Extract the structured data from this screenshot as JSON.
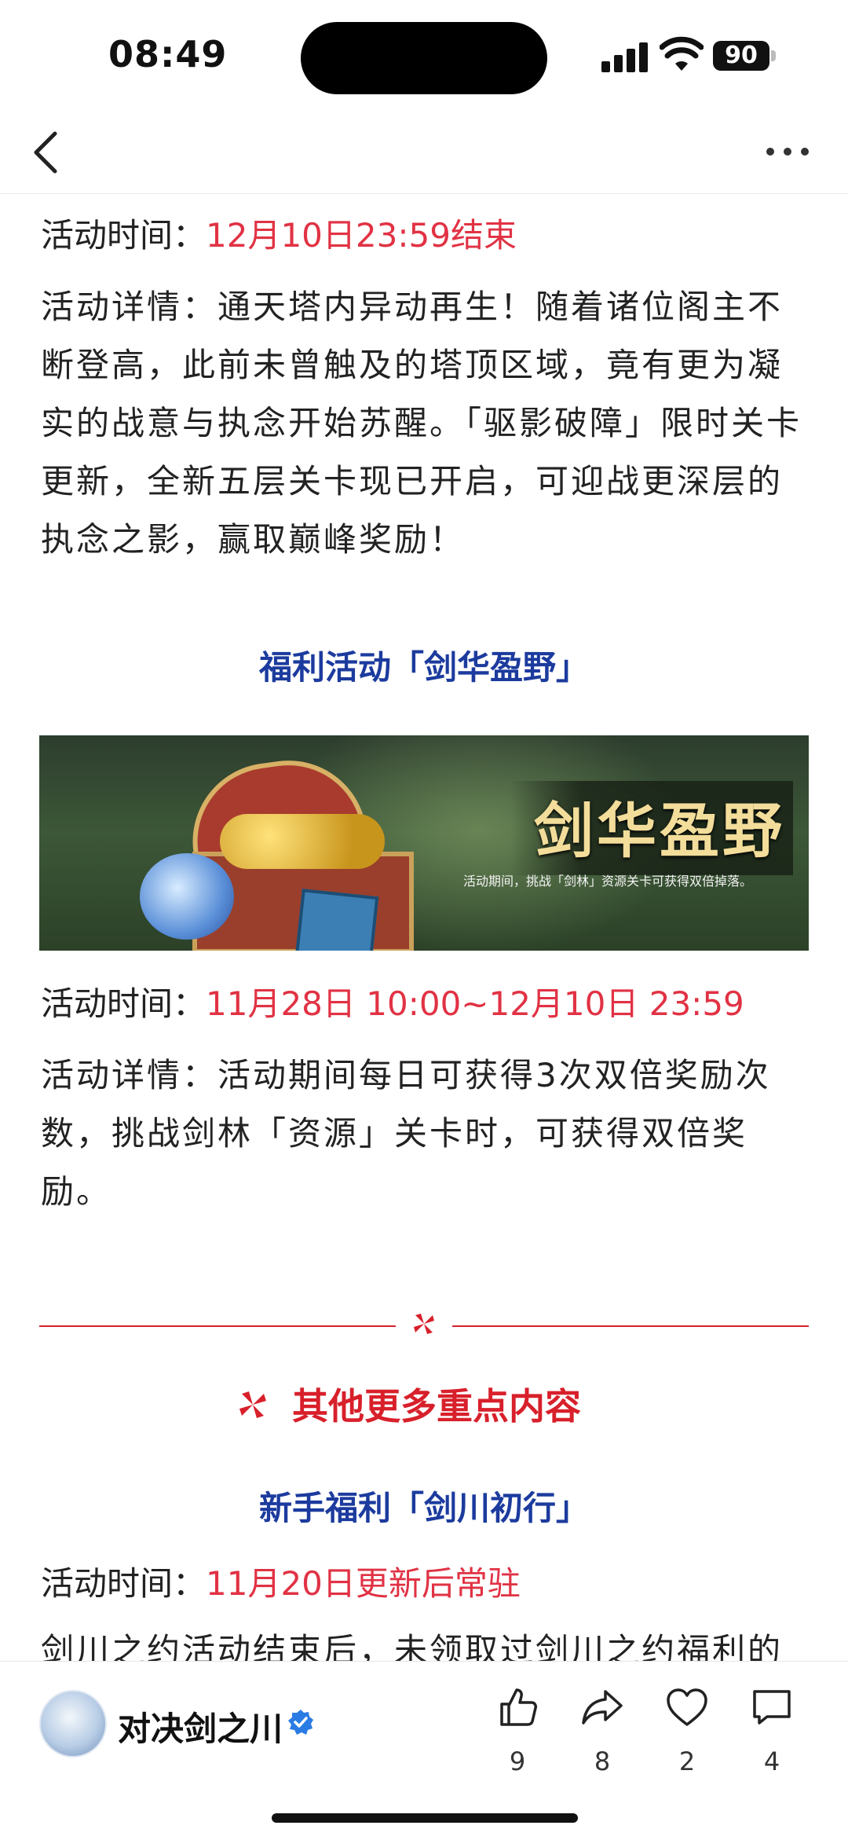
{
  "status_bar": {
    "time": "08:49",
    "battery": "90"
  },
  "nav": {
    "back_icon": "chevron-left-icon",
    "more_icon": "more-dots-icon"
  },
  "article": {
    "block1": {
      "time_label": "活动时间：",
      "time_value": "12月10日23:59结束",
      "detail": "活动详情：通天塔内异动再生！随着诸位阁主不断登高，此前未曾触及的塔顶区域，竟有更为凝实的战意与执念开始苏醒。「驱影破障」限时关卡更新，全新五层关卡现已开启，可迎战更深层的执念之影，赢取巅峰奖励！"
    },
    "block2": {
      "title": "福利活动「剑华盈野」",
      "banner_title": "剑华盈野",
      "banner_caption": "活动期间，挑战「剑林」资源关卡可获得双倍掉落。",
      "time_label": "活动时间：",
      "time_value": "11月28日 10:00~12月10日 23:59",
      "detail": "活动详情：活动期间每日可获得3次双倍奖励次数，挑战剑林「资源」关卡时，可获得双倍奖励。"
    },
    "section_heading": "其他更多重点内容",
    "block3": {
      "title": "新手福利「剑川初行」",
      "time_label": "活动时间：",
      "time_value": "11月20日更新后常驻",
      "detail_partial": "剑川之约活动结束后，未领取过剑川之约福利的"
    }
  },
  "bottom_bar": {
    "author": "对决剑之川",
    "likes": "9",
    "shares": "8",
    "favorites": "2",
    "comments": "4"
  },
  "colors": {
    "accent_red": "#e13244",
    "title_blue": "#1c3b9e",
    "divider_red": "#d8202b"
  }
}
